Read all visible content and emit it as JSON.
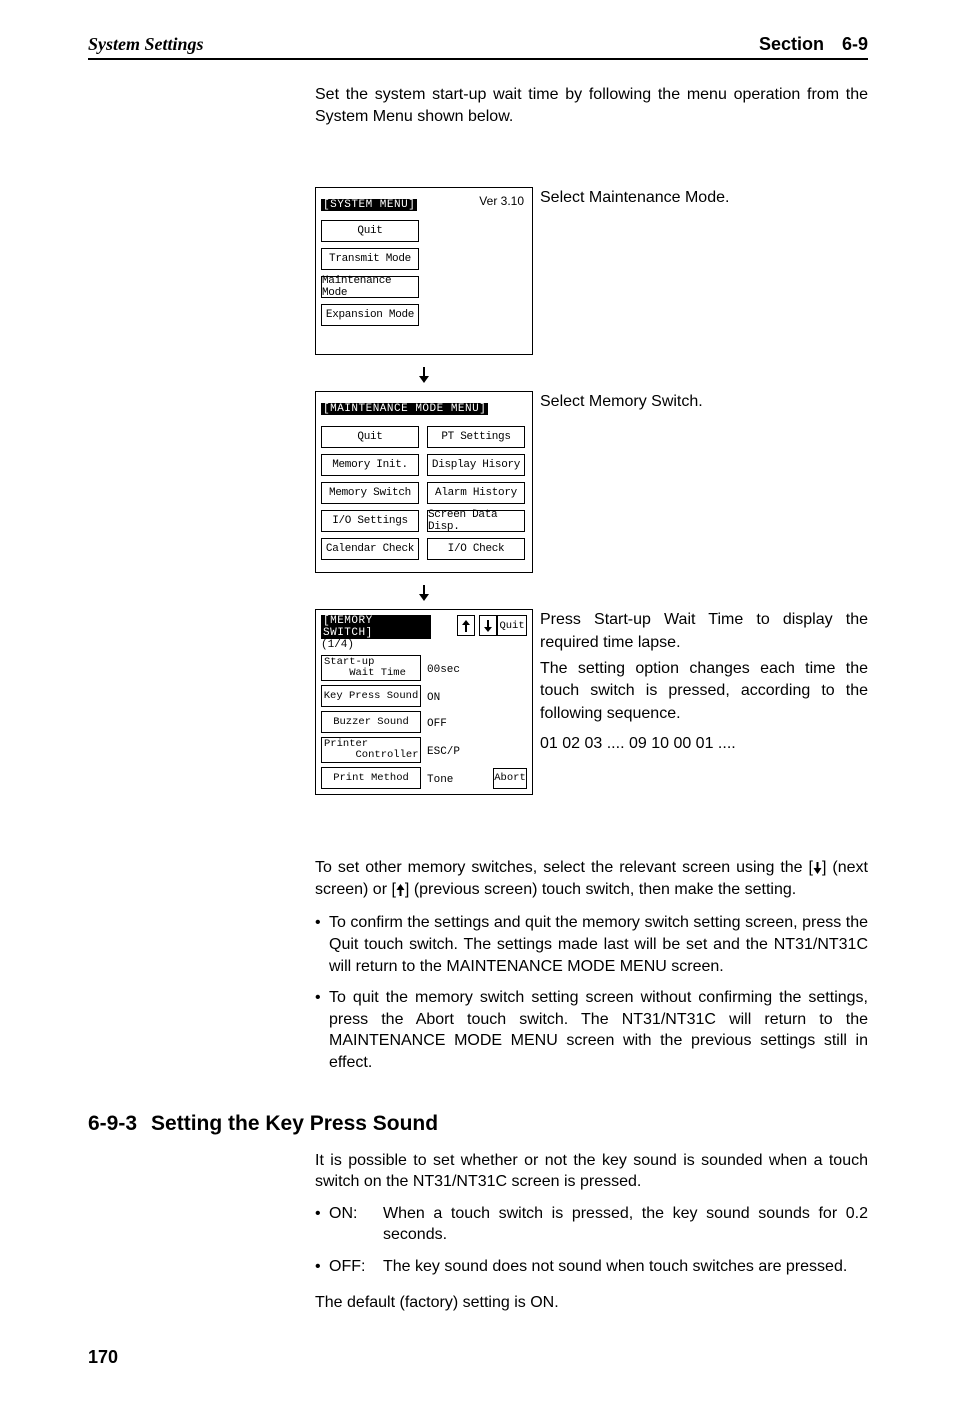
{
  "header": {
    "left": "System Settings",
    "right_label": "Section",
    "right_num": "6-9"
  },
  "intro": "Set the system start-up wait time by following the menu operation from the System Menu shown below.",
  "fig1": {
    "title": "[SYSTEM MENU]",
    "version": "Ver 3.10",
    "btn1": "Quit",
    "btn2": "Transmit Mode",
    "btn3": "Maintenance Mode",
    "btn4": "Expansion Mode",
    "note": "Select Maintenance Mode."
  },
  "fig2": {
    "title": "[MAINTENANCE MODE MENU]",
    "b1": "Quit",
    "b2": "PT Settings",
    "b3": "Memory Init.",
    "b4": "Display Hisory",
    "b5": "Memory Switch",
    "b6": "Alarm History",
    "b7": "I/O Settings",
    "b8": "Screen Data Disp.",
    "b9": "Calendar Check",
    "b10": "I/O Check",
    "note": "Select Memory Switch."
  },
  "fig3": {
    "title": "[MEMORY SWITCH]",
    "page": "(1/4)",
    "quit": "Quit",
    "abort": "Abort",
    "r1l": "Start-up\n    Wait Time",
    "r1v": "00sec",
    "r2l": "Key Press Sound",
    "r2v": "ON",
    "r3l": "Buzzer Sound",
    "r3v": "OFF",
    "r4l": "Printer\n     Controller",
    "r4v": "ESC/P",
    "r5l": "Print Method",
    "r5v": "Tone",
    "note1": "Press Start-up Wait Time to display the required time lapse.",
    "note2": "The setting option changes each time the touch switch is pressed, according to the following sequence.",
    "note3": "01  02  03  ....  09  10  00  01  ...."
  },
  "after": {
    "p1a": "To set other memory switches, select the relevant screen using the [",
    "p1b": "] (next screen) or [",
    "p1c": "] (previous screen) touch switch, then make the setting.",
    "b1": "To confirm the settings and quit the memory switch setting screen, press the Quit touch switch. The settings made last will be set and the NT31/NT31C will return to the MAINTENANCE MODE MENU screen.",
    "b2": "To quit the memory switch setting screen without confirming the settings, press the Abort touch switch. The NT31/NT31C will return to the MAINTENANCE MODE MENU screen with the previous settings still in effect."
  },
  "sub": {
    "num": "6-9-3",
    "title": "Setting the Key Press Sound",
    "intro": "It is possible to set whether or not the key sound is sounded when a touch switch on the NT31/NT31C screen is pressed.",
    "on_label": "ON:",
    "on_text": "When a touch switch is pressed, the key sound sounds for 0.2 seconds.",
    "off_label": "OFF:",
    "off_text": "The key sound does not sound when touch switches are pressed.",
    "footer": "The default (factory) setting is ON."
  },
  "pagenum": "170"
}
